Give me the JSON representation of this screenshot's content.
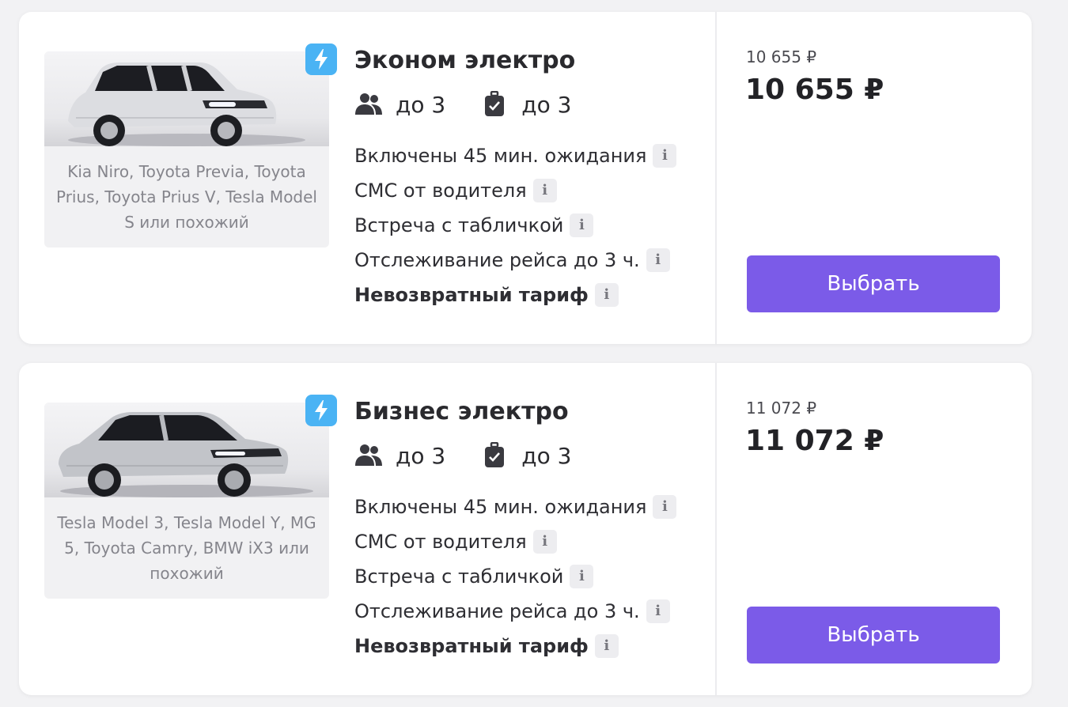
{
  "colors": {
    "accent_button": "#7b5be8",
    "electric_badge": "#4ab3f4",
    "card_background": "#ffffff",
    "page_background": "#f2f2f4"
  },
  "tariffs": [
    {
      "badge_icon": "lightning-icon",
      "title": "Эконом электро",
      "passengers": "до 3",
      "luggage": "до 3",
      "car_models": "Kia Niro, Toyota Previa, Toyota Prius, Toyota Prius V, Tesla Model S или похожий",
      "features": [
        "Включены 45 мин. ожидания",
        "СМС от водителя",
        "Встреча с табличкой",
        "Отслеживание рейса до 3 ч.",
        "Невозвратный тариф"
      ],
      "info_label": "i",
      "old_price": "10 655 ₽",
      "price": "10 655 ₽",
      "button_label": "Выбрать"
    },
    {
      "badge_icon": "lightning-icon",
      "title": "Бизнес электро",
      "passengers": "до 3",
      "luggage": "до 3",
      "car_models": "Tesla Model 3, Tesla Model Y, MG 5, Toyota Camry, BMW iX3 или похожий",
      "features": [
        "Включены 45 мин. ожидания",
        "СМС от водителя",
        "Встреча с табличкой",
        "Отслеживание рейса до 3 ч.",
        "Невозвратный тариф"
      ],
      "info_label": "i",
      "old_price": "11 072 ₽",
      "price": "11 072 ₽",
      "button_label": "Выбрать"
    }
  ]
}
